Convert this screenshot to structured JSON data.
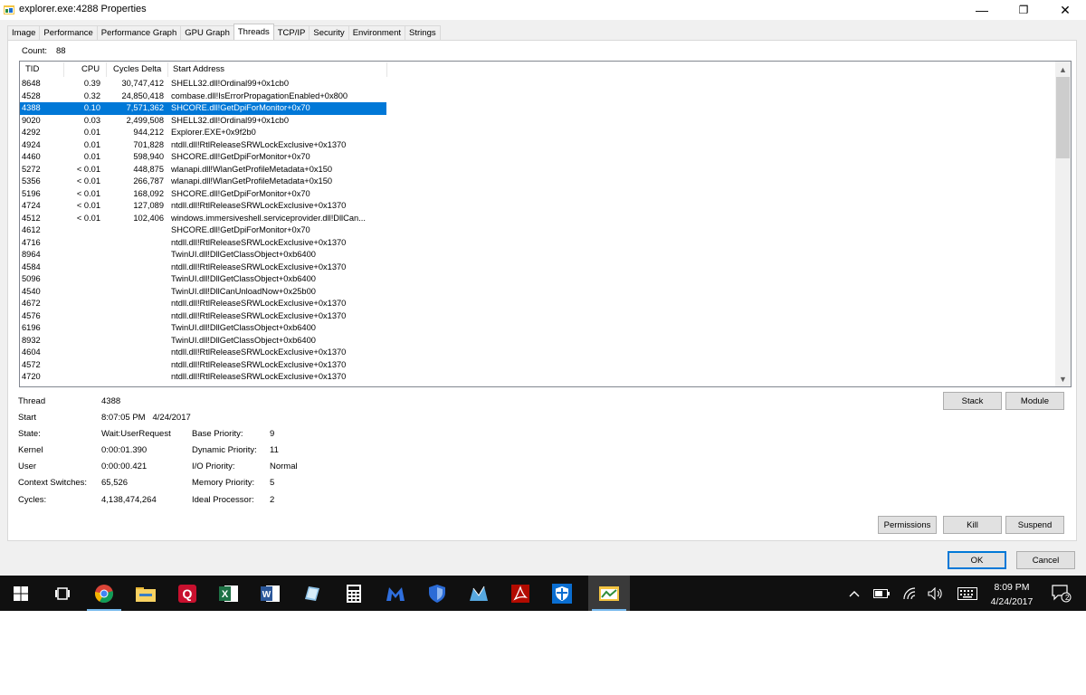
{
  "window": {
    "title": "explorer.exe:4288 Properties",
    "minimize_glyph": "—",
    "maximize_glyph": "❐",
    "close_glyph": "✕"
  },
  "tabs": [
    "Image",
    "Performance",
    "Performance Graph",
    "GPU Graph",
    "Threads",
    "TCP/IP",
    "Security",
    "Environment",
    "Strings"
  ],
  "active_tab": "Threads",
  "count": {
    "label": "Count:",
    "value": "88"
  },
  "columns": {
    "tid": "TID",
    "cpu": "CPU",
    "cycles": "Cycles Delta",
    "address": "Start Address"
  },
  "threads": [
    {
      "tid": "8648",
      "cpu": "0.39",
      "cycles": "30,747,412",
      "address": "SHELL32.dll!Ordinal99+0x1cb0"
    },
    {
      "tid": "4528",
      "cpu": "0.32",
      "cycles": "24,850,418",
      "address": "combase.dll!IsErrorPropagationEnabled+0x800"
    },
    {
      "tid": "4388",
      "cpu": "0.10",
      "cycles": "7,571,362",
      "address": "SHCORE.dll!GetDpiForMonitor+0x70",
      "selected": true
    },
    {
      "tid": "9020",
      "cpu": "0.03",
      "cycles": "2,499,508",
      "address": "SHELL32.dll!Ordinal99+0x1cb0"
    },
    {
      "tid": "4292",
      "cpu": "0.01",
      "cycles": "944,212",
      "address": "Explorer.EXE+0x9f2b0"
    },
    {
      "tid": "4924",
      "cpu": "0.01",
      "cycles": "701,828",
      "address": "ntdll.dll!RtlReleaseSRWLockExclusive+0x1370"
    },
    {
      "tid": "4460",
      "cpu": "0.01",
      "cycles": "598,940",
      "address": "SHCORE.dll!GetDpiForMonitor+0x70"
    },
    {
      "tid": "5272",
      "cpu": "< 0.01",
      "cycles": "448,875",
      "address": "wlanapi.dll!WlanGetProfileMetadata+0x150"
    },
    {
      "tid": "5356",
      "cpu": "< 0.01",
      "cycles": "266,787",
      "address": "wlanapi.dll!WlanGetProfileMetadata+0x150"
    },
    {
      "tid": "5196",
      "cpu": "< 0.01",
      "cycles": "168,092",
      "address": "SHCORE.dll!GetDpiForMonitor+0x70"
    },
    {
      "tid": "4724",
      "cpu": "< 0.01",
      "cycles": "127,089",
      "address": "ntdll.dll!RtlReleaseSRWLockExclusive+0x1370"
    },
    {
      "tid": "4512",
      "cpu": "< 0.01",
      "cycles": "102,406",
      "address": "windows.immersiveshell.serviceprovider.dll!DllCan..."
    },
    {
      "tid": "4612",
      "cpu": "",
      "cycles": "",
      "address": "SHCORE.dll!GetDpiForMonitor+0x70"
    },
    {
      "tid": "4716",
      "cpu": "",
      "cycles": "",
      "address": "ntdll.dll!RtlReleaseSRWLockExclusive+0x1370"
    },
    {
      "tid": "8964",
      "cpu": "",
      "cycles": "",
      "address": "TwinUI.dll!DllGetClassObject+0xb6400"
    },
    {
      "tid": "4584",
      "cpu": "",
      "cycles": "",
      "address": "ntdll.dll!RtlReleaseSRWLockExclusive+0x1370"
    },
    {
      "tid": "5096",
      "cpu": "",
      "cycles": "",
      "address": "TwinUI.dll!DllGetClassObject+0xb6400"
    },
    {
      "tid": "4540",
      "cpu": "",
      "cycles": "",
      "address": "TwinUI.dll!DllCanUnloadNow+0x25b00"
    },
    {
      "tid": "4672",
      "cpu": "",
      "cycles": "",
      "address": "ntdll.dll!RtlReleaseSRWLockExclusive+0x1370"
    },
    {
      "tid": "4576",
      "cpu": "",
      "cycles": "",
      "address": "ntdll.dll!RtlReleaseSRWLockExclusive+0x1370"
    },
    {
      "tid": "6196",
      "cpu": "",
      "cycles": "",
      "address": "TwinUI.dll!DllGetClassObject+0xb6400"
    },
    {
      "tid": "8932",
      "cpu": "",
      "cycles": "",
      "address": "TwinUI.dll!DllGetClassObject+0xb6400"
    },
    {
      "tid": "4604",
      "cpu": "",
      "cycles": "",
      "address": "ntdll.dll!RtlReleaseSRWLockExclusive+0x1370"
    },
    {
      "tid": "4572",
      "cpu": "",
      "cycles": "",
      "address": "ntdll.dll!RtlReleaseSRWLockExclusive+0x1370"
    },
    {
      "tid": "4720",
      "cpu": "",
      "cycles": "",
      "address": "ntdll.dll!RtlReleaseSRWLockExclusive+0x1370"
    }
  ],
  "details": {
    "thread_label": "Thread",
    "thread_value": "4388",
    "start_label": "Start",
    "start_value": "8:07:05 PM   4/24/2017",
    "state_label": "State:",
    "state_value": "Wait:UserRequest",
    "kernel_label": "Kernel",
    "kernel_value": "0:00:01.390",
    "user_label": "User",
    "user_value": "0:00:00.421",
    "ctx_label": "Context Switches:",
    "ctx_value": "65,526",
    "cycles_label": "Cycles:",
    "cycles_value": "4,138,474,264",
    "base_priority_label": "Base Priority:",
    "base_priority_value": "9",
    "dynamic_priority_label": "Dynamic Priority:",
    "dynamic_priority_value": "11",
    "io_priority_label": "I/O Priority:",
    "io_priority_value": "Normal",
    "memory_priority_label": "Memory Priority:",
    "memory_priority_value": "5",
    "ideal_processor_label": "Ideal Processor:",
    "ideal_processor_value": "2"
  },
  "buttons": {
    "stack": "Stack",
    "module": "Module",
    "permissions": "Permissions",
    "kill": "Kill",
    "suspend": "Suspend",
    "ok": "OK",
    "cancel": "Cancel"
  },
  "taskbar": {
    "icons": [
      "start-icon",
      "task-view-icon",
      "chrome-icon",
      "file-explorer-icon",
      "quicken-icon",
      "excel-icon",
      "word-icon",
      "notepad-icon",
      "calculator-icon",
      "malwarebytes-icon",
      "defender-icon",
      "network-icon",
      "acrobat-icon",
      "security-shield-icon",
      "process-explorer-icon"
    ],
    "clock_time": "8:09 PM",
    "clock_date": "4/24/2017",
    "notification_count": "2"
  },
  "colors": {
    "selection": "#0078d7",
    "taskbar": "#101010",
    "window_bg": "#f0f0f0"
  }
}
